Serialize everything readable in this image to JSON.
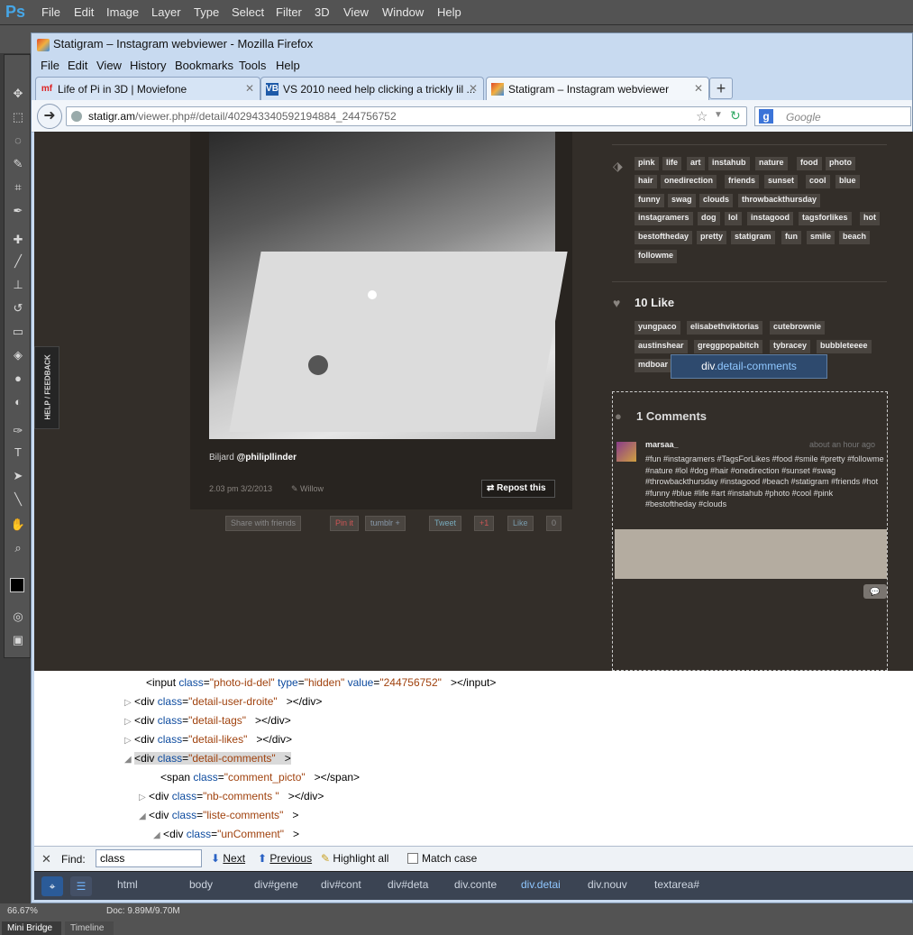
{
  "photoshop": {
    "logo": "Ps",
    "menu": [
      "File",
      "Edit",
      "Image",
      "Layer",
      "Type",
      "Select",
      "Filter",
      "3D",
      "View",
      "Window",
      "Help"
    ],
    "zoom": "66.67%",
    "doc": "Doc: 9.89M/9.70M",
    "bottom_tabs": [
      "Mini Bridge",
      "Timeline"
    ]
  },
  "firefox": {
    "title": "Statigram – Instagram webviewer - Mozilla Firefox",
    "menu": [
      "File",
      "Edit",
      "View",
      "History",
      "Bookmarks",
      "Tools",
      "Help"
    ],
    "tabs": [
      {
        "label": "Life of Pi in 3D | Moviefone",
        "favicon": "mf"
      },
      {
        "label": "VS 2010 need help clicking a trickly lil ...",
        "favicon": "VB"
      },
      {
        "label": "Statigram – Instagram webviewer",
        "favicon": "st"
      }
    ],
    "url_host": "statigr.am",
    "url_path": "/viewer.php#/detail/402943340592194884_244756752",
    "search_placeholder": "Google"
  },
  "page": {
    "caption_text": "Biljard ",
    "caption_user": "@philipllinder",
    "photo_time": "2.03 pm 3/2/2013",
    "filter": "Willow",
    "repost": "Repost this",
    "share_buttons": [
      "Share with friends",
      "Pin it",
      "tumblr +",
      "Tweet",
      "+1",
      "Like",
      "0"
    ],
    "help_feedback": "HELP / FEEDBACK",
    "tags": [
      "pink",
      "life",
      "art",
      "instahub",
      "nature",
      "food",
      "photo",
      "hair",
      "onedirection",
      "friends",
      "sunset",
      "cool",
      "blue",
      "funny",
      "swag",
      "clouds",
      "throwbackthursday",
      "instagramers",
      "dog",
      "lol",
      "instagood",
      "tagsforlikes",
      "hot",
      "bestoftheday",
      "pretty",
      "statigram",
      "fun",
      "smile",
      "beach",
      "followme"
    ],
    "likes_title": "10 Like",
    "likers": [
      "yungpaco",
      "elisabethviktorias",
      "cutebrownie",
      "austinshear",
      "greggpopabitch",
      "tybracey",
      "bubbleteeee",
      "mdboar"
    ],
    "tooltip_prefix": "div",
    "tooltip_class": ".detail-comments",
    "comments_title": "1 Comments",
    "comment_user": "marsaa_",
    "comment_time": "about an hour ago",
    "comment_text": "#fun #instagramers #TagsForLikes #food #smile #pretty #followme #nature #lol #dog #hair #onedirection #sunset #swag #throwbackthursday #instagood #beach #statigram #friends #hot #funny #blue #life #art #instahub #photo #cool #pink #bestoftheday #clouds"
  },
  "devtools": {
    "lines": [
      {
        "tag": "input",
        "attrs": [
          [
            "class",
            "photo-id-del"
          ],
          [
            "type",
            "hidden"
          ],
          [
            "value",
            "244756752"
          ]
        ],
        "close": "></input>"
      },
      {
        "tag": "div",
        "attrs": [
          [
            "class",
            "detail-user-droite"
          ]
        ],
        "close": "></div>"
      },
      {
        "tag": "div",
        "attrs": [
          [
            "class",
            "detail-tags"
          ]
        ],
        "close": "></div>"
      },
      {
        "tag": "div",
        "attrs": [
          [
            "class",
            "detail-likes"
          ]
        ],
        "close": "></div>"
      },
      {
        "tag": "div",
        "attrs": [
          [
            "class",
            "detail-comments"
          ]
        ],
        "close": ">"
      },
      {
        "tag": "span",
        "attrs": [
          [
            "class",
            "comment_picto"
          ]
        ],
        "close": "></span>"
      },
      {
        "tag": "div",
        "attrs": [
          [
            "class",
            "nb-comments "
          ]
        ],
        "close": "></div>"
      },
      {
        "tag": "div",
        "attrs": [
          [
            "class",
            "liste-comments"
          ]
        ],
        "close": ">"
      },
      {
        "tag": "div",
        "attrs": [
          [
            "class",
            "unComment"
          ]
        ],
        "close": ">"
      }
    ],
    "find_label": "Find:",
    "find_value": "class",
    "find_next": "Next",
    "find_previous": "Previous",
    "find_highlight": "Highlight all",
    "find_match_case": "Match case",
    "breadcrumbs": [
      "html",
      "body",
      "div#gene",
      "div#cont",
      "div#deta",
      "div.conte",
      "div.detai",
      "div.nouv",
      "textarea#"
    ]
  }
}
